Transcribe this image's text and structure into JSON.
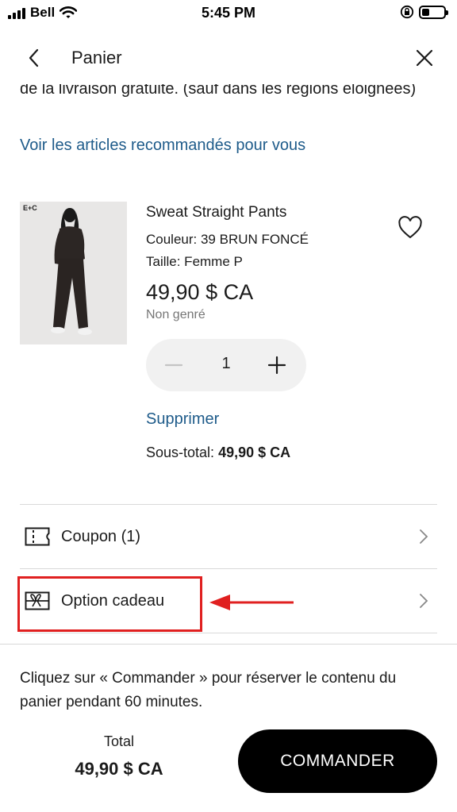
{
  "status_bar": {
    "carrier": "Bell",
    "time": "5:45 PM"
  },
  "header": {
    "title": "Panier"
  },
  "promo": {
    "cut_text": "de la livraison gratuite. (sauf dans les régions éloignées)",
    "recommend_link": "Voir les articles recommandés pour vous"
  },
  "product": {
    "image_logo": "E+C",
    "name": "Sweat Straight Pants",
    "color": "Couleur: 39 BRUN FONCÉ",
    "size": "Taille: Femme P",
    "price": "49,90 $ CA",
    "gender": "Non genré",
    "quantity": "1",
    "remove_label": "Supprimer",
    "subtotal_label": "Sous-total:",
    "subtotal_value": "49,90 $ CA"
  },
  "options": {
    "coupon_label": "Coupon (1)",
    "gift_label": "Option cadeau"
  },
  "footer": {
    "notice": "Cliquez sur « Commander » pour réserver le contenu du panier pendant 60 minutes.",
    "total_label": "Total",
    "total_value": "49,90 $ CA",
    "checkout_label": "COMMANDER"
  },
  "colors": {
    "link": "#1e5b8a",
    "highlight": "#e02020",
    "button": "#000000"
  }
}
